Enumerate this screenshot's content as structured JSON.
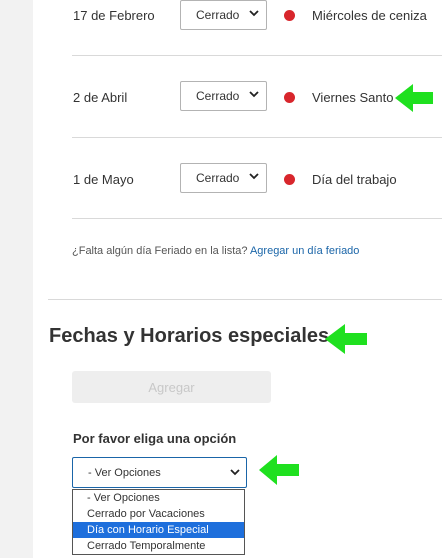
{
  "holidays": [
    {
      "date": "17 de Febrero",
      "status": "Cerrado",
      "name": "Miércoles de ceniza"
    },
    {
      "date": "2 de Abril",
      "status": "Cerrado",
      "name": "Viernes Santo"
    },
    {
      "date": "1 de Mayo",
      "status": "Cerrado",
      "name": "Día del trabajo"
    }
  ],
  "missing": {
    "question": "¿Falta algún día Feriado en la lista? ",
    "link": "Agregar un día feriado"
  },
  "special": {
    "title": "Fechas y Horarios especiales",
    "add_button": "Agregar",
    "option_label": "Por favor eliga una opción",
    "select_value": "- Ver Opciones",
    "options": [
      "- Ver Opciones",
      "Cerrado por Vacaciones",
      "Día con Horario Especial",
      "Cerrado Temporalmente"
    ],
    "selected_option": "Día con Horario Especial"
  },
  "colors": {
    "accent": "#1a65a8",
    "status_dot": "#d8262c",
    "arrow": "#1fe01f",
    "highlight": "#1e6fdc"
  }
}
